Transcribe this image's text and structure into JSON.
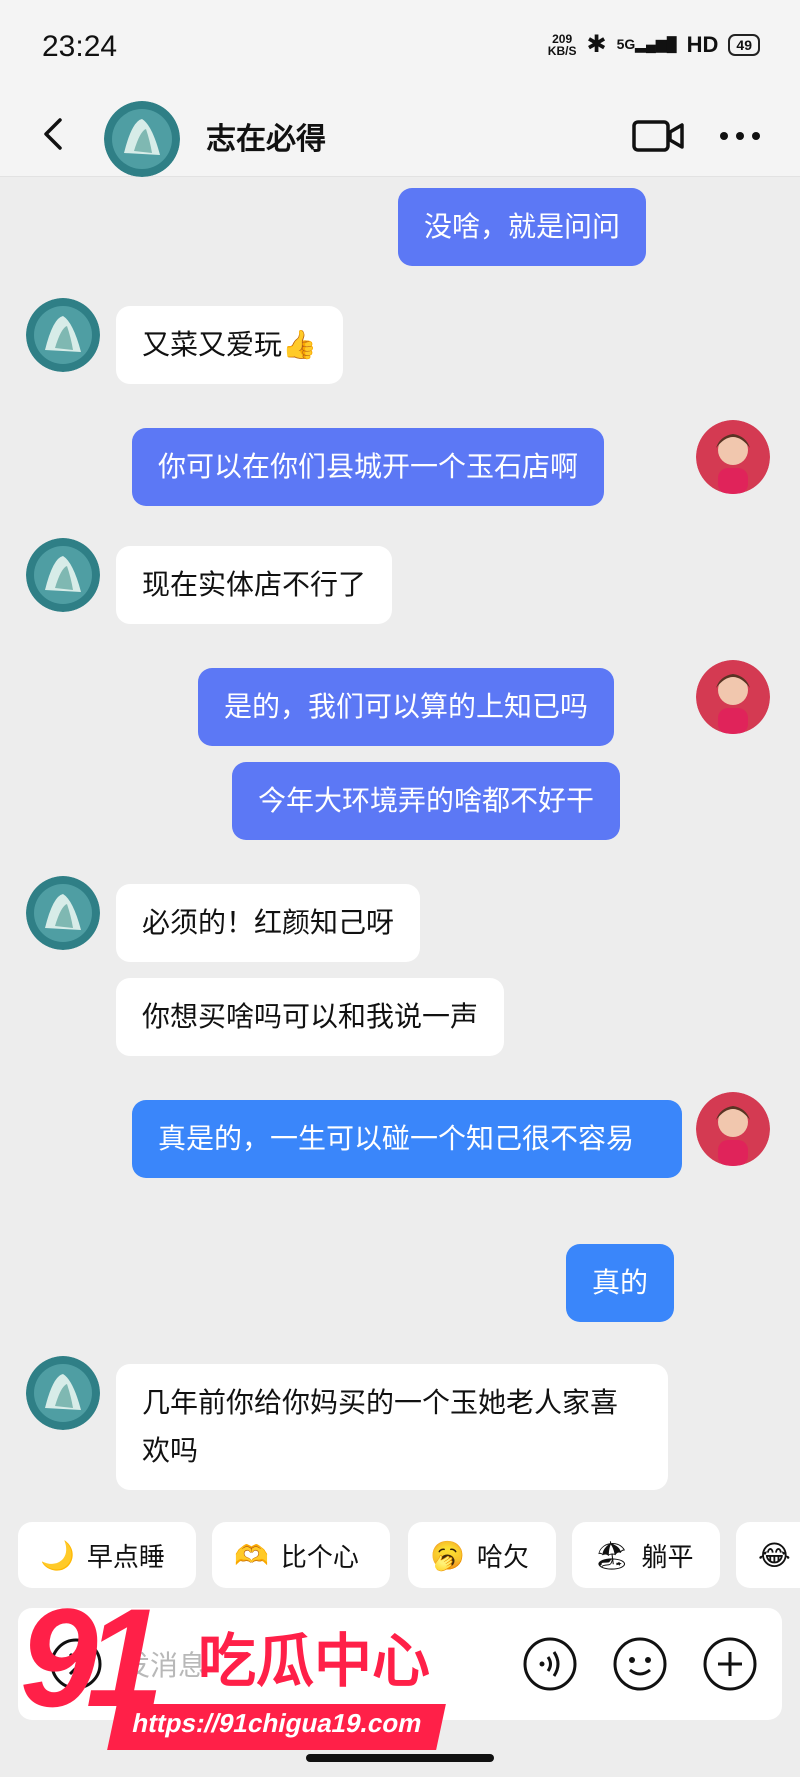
{
  "status": {
    "time": "23:24",
    "speed_top": "209",
    "speed_bottom": "KB/S",
    "net": "5G",
    "hd": "HD",
    "battery": "49"
  },
  "header": {
    "name": "志在必得"
  },
  "messages": [
    {
      "text": "没啥，就是问问"
    },
    {
      "text": "又菜又爱玩👍"
    },
    {
      "text": "你可以在你们县城开一个玉石店啊"
    },
    {
      "text": "现在实体店不行了"
    },
    {
      "text": "是的，我们可以算的上知已吗"
    },
    {
      "text": "今年大环境弄的啥都不好干"
    },
    {
      "text": "必须的！红颜知己呀"
    },
    {
      "text": "你想买啥吗可以和我说一声"
    },
    {
      "text": "真是的，一生可以碰一个知己很不容易"
    },
    {
      "text": "真的"
    },
    {
      "text": "几年前你给你妈买的一个玉她老人家喜欢吗"
    }
  ],
  "quick_replies": [
    {
      "emoji": "🌙",
      "label": "早点睡"
    },
    {
      "emoji": "🫶",
      "label": "比个心"
    },
    {
      "emoji": "🥱",
      "label": "哈欠"
    },
    {
      "emoji": "🏖",
      "label": "躺平"
    },
    {
      "emoji": "😂",
      "label": ""
    }
  ],
  "input": {
    "placeholder": "发消息"
  },
  "watermark": {
    "number": "91",
    "title": "吃瓜中心",
    "url": "https://91chigua19.com"
  },
  "colors": {
    "bubble_out": "#5c78f5",
    "bubble_out_alt": "#3a86fa",
    "watermark": "#ff2048"
  }
}
